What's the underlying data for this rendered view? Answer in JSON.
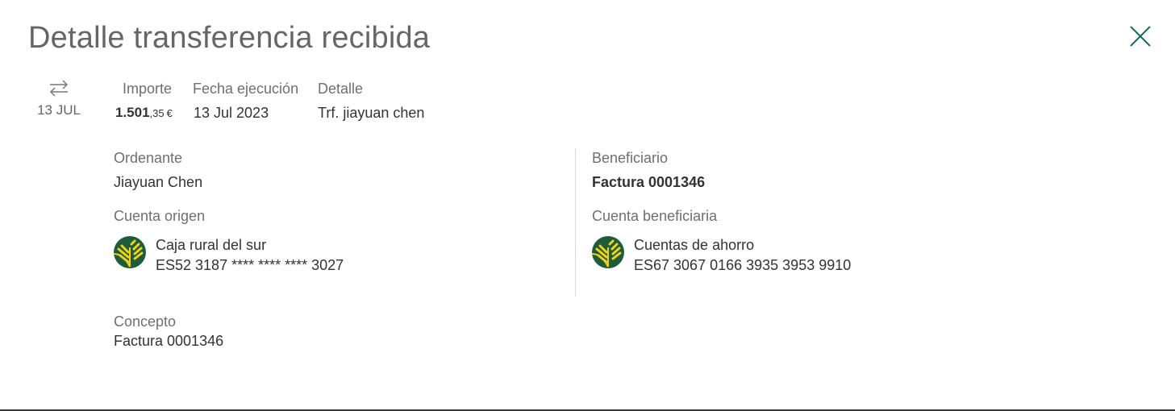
{
  "title": "Detalle transferencia recibida",
  "icons": {
    "close": "close-icon",
    "transfer": "transfer-arrows-icon",
    "bank": "caja-rural-logo-icon"
  },
  "colors": {
    "accent": "#1a6b5e",
    "logo_green": "#1e5c3c",
    "logo_yellow": "#f2d01c"
  },
  "summary": {
    "date": "13 JUL",
    "importe_label": "Importe",
    "importe_int": "1.501",
    "importe_dec": ",35",
    "importe_currency": "€",
    "fecha_label": "Fecha ejecución",
    "fecha_value": "13 Jul 2023",
    "detalle_label": "Detalle",
    "detalle_value": "Trf. jiayuan chen"
  },
  "ordenante": {
    "label": "Ordenante",
    "name": "Jiayuan Chen",
    "account_label": "Cuenta origen",
    "bank_name": "Caja rural del sur",
    "iban": "ES52 3187 **** **** **** 3027"
  },
  "beneficiario": {
    "label": "Beneficiario",
    "name": "Factura 0001346",
    "account_label": "Cuenta beneficiaria",
    "account_name": "Cuentas de ahorro",
    "iban": "ES67 3067 0166 3935 3953 9910"
  },
  "concepto": {
    "label": "Concepto",
    "value": "Factura 0001346"
  }
}
